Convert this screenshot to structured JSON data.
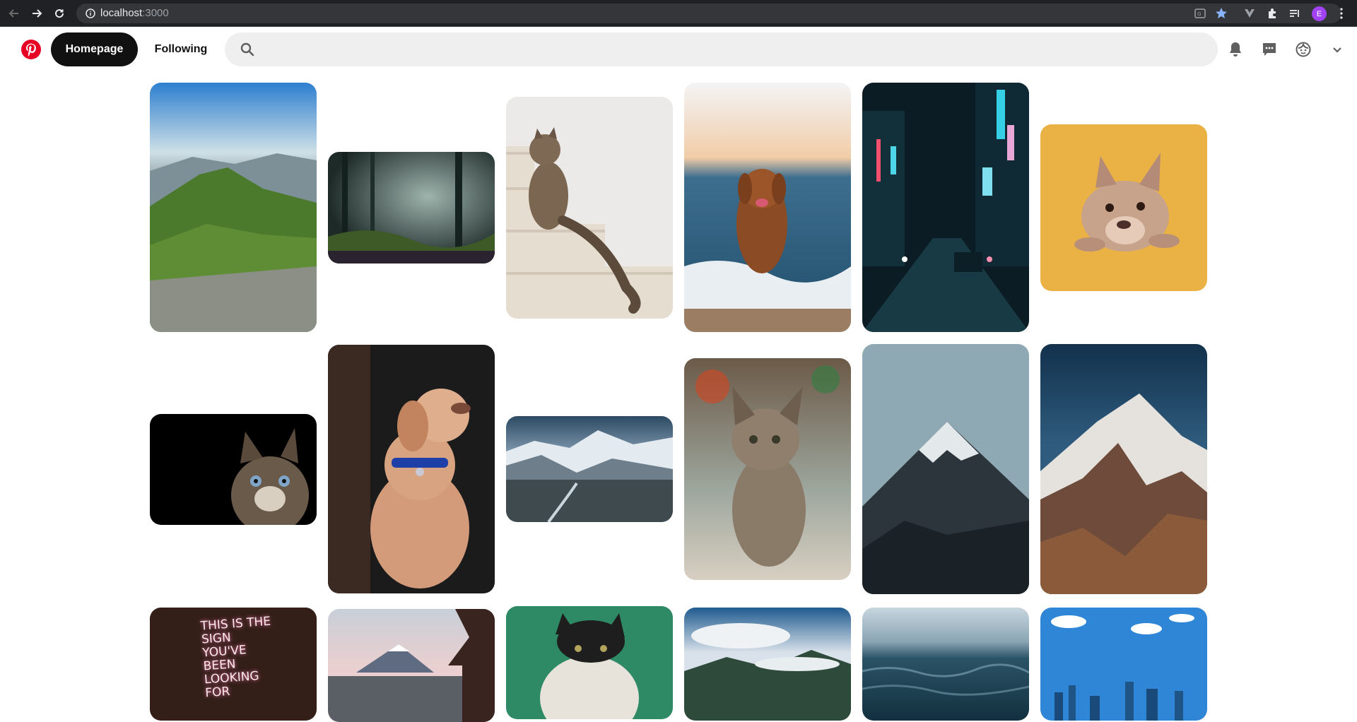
{
  "browser": {
    "url_host": "localhost",
    "url_port": ":3000",
    "profile_initial": "E"
  },
  "header": {
    "home_label": "Homepage",
    "following_label": "Following",
    "search_placeholder": ""
  },
  "colors": {
    "brand": "#e60023",
    "active_tab_bg": "#111111",
    "search_bg": "#efefef"
  },
  "icons": [
    "pinterest-logo-icon",
    "search-icon",
    "bell-icon",
    "chat-icon",
    "profile-face-icon",
    "chevron-down-icon"
  ],
  "pins": [
    {
      "subject": "green mountains"
    },
    {
      "subject": "misty forest"
    },
    {
      "subject": "cat on stairs"
    },
    {
      "subject": "dog running on beach"
    },
    {
      "subject": "neon city street"
    },
    {
      "subject": "french bulldog on yellow"
    },
    {
      "subject": "cat in dark"
    },
    {
      "subject": "puppy with blue collar"
    },
    {
      "subject": "snowy mountain valley"
    },
    {
      "subject": "tabby kitten"
    },
    {
      "subject": "snowy peak"
    },
    {
      "subject": "snow capped mountain"
    },
    {
      "subject": "neon sign",
      "text": "THIS IS THE SIGN YOU'VE BEEN LOOKING FOR"
    },
    {
      "subject": "mount fuji with pagoda"
    },
    {
      "subject": "black and white cat"
    },
    {
      "subject": "clouds over mountains"
    },
    {
      "subject": "ocean waves"
    },
    {
      "subject": "city skyline blue sky"
    }
  ]
}
